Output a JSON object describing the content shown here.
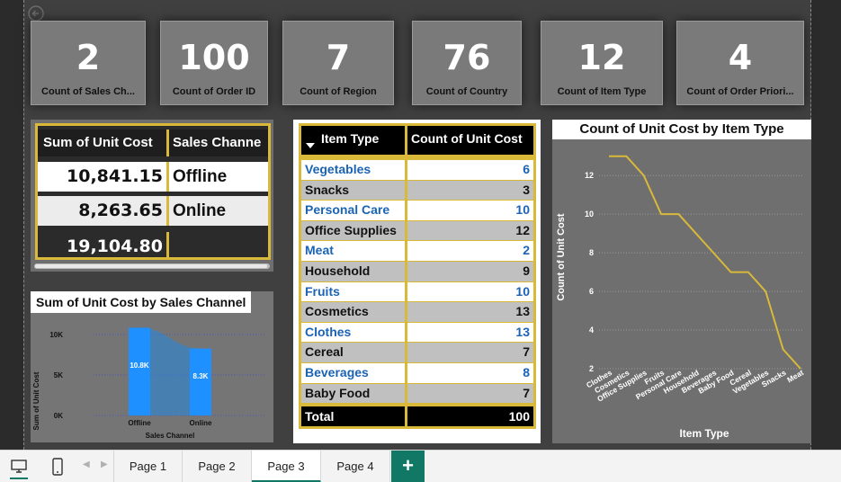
{
  "kpis": [
    {
      "value": "2",
      "label": "Count of Sales Ch..."
    },
    {
      "value": "100",
      "label": "Count of Order ID"
    },
    {
      "value": "7",
      "label": "Count of Region"
    },
    {
      "value": "76",
      "label": "Count of Country"
    },
    {
      "value": "12",
      "label": "Count of Item Type"
    },
    {
      "value": "4",
      "label": "Count of Order Priori..."
    }
  ],
  "matrix": {
    "headers": [
      "Sum of Unit Cost",
      "Sales Channe"
    ],
    "rows": [
      {
        "cost": "10,841.15",
        "channel": "Offline"
      },
      {
        "cost": "8,263.65",
        "channel": "Online"
      }
    ],
    "total": "19,104.80"
  },
  "bar_chart_title": "Sum of Unit Cost by Sales Channel",
  "line_chart_title": "Count of Unit Cost by Item Type",
  "table": {
    "headers": [
      "Item Type",
      "Count of Unit Cost"
    ],
    "rows": [
      {
        "item": "Vegetables",
        "count": "6"
      },
      {
        "item": "Snacks",
        "count": "3"
      },
      {
        "item": "Personal Care",
        "count": "10"
      },
      {
        "item": "Office Supplies",
        "count": "12"
      },
      {
        "item": "Meat",
        "count": "2"
      },
      {
        "item": "Household",
        "count": "9"
      },
      {
        "item": "Fruits",
        "count": "10"
      },
      {
        "item": "Cosmetics",
        "count": "13"
      },
      {
        "item": "Clothes",
        "count": "13"
      },
      {
        "item": "Cereal",
        "count": "7"
      },
      {
        "item": "Beverages",
        "count": "8"
      },
      {
        "item": "Baby Food",
        "count": "7"
      }
    ],
    "total_label": "Total",
    "total_value": "100"
  },
  "chart_data": [
    {
      "type": "area",
      "title": "Sum of Unit Cost by Sales Channel",
      "categories": [
        "Offline",
        "Online"
      ],
      "values": [
        10841.15,
        8263.65
      ],
      "data_labels": [
        "10.8K",
        "8.3K"
      ],
      "xlabel": "Sales Channel",
      "ylabel": "Sum of Unit Cost",
      "yticks": [
        "0K",
        "5K",
        "10K"
      ],
      "ylim": [
        0,
        12000
      ],
      "grid": true,
      "bar_color": "#1e90ff"
    },
    {
      "type": "line",
      "title": "Count of Unit Cost by Item Type",
      "categories": [
        "Clothes",
        "Cosmetics",
        "Office Supplies",
        "Fruits",
        "Personal Care",
        "Household",
        "Beverages",
        "Baby Food",
        "Cereal",
        "Vegetables",
        "Snacks",
        "Meat"
      ],
      "values": [
        13,
        13,
        12,
        10,
        10,
        9,
        8,
        7,
        7,
        6,
        3,
        2
      ],
      "xlabel": "Item Type",
      "ylabel": "Count of Unit Cost",
      "yticks": [
        "2",
        "4",
        "6",
        "8",
        "10",
        "12"
      ],
      "ylim": [
        2,
        13.5
      ],
      "grid": true,
      "line_color": "#d8b93a"
    }
  ],
  "tabs": [
    "Page 1",
    "Page 2",
    "Page 3",
    "Page 4"
  ],
  "active_tab": "Page 3",
  "add_tab_label": "+",
  "colors": {
    "accent": "#117865",
    "gold": "#d8b93a",
    "link": "#1a63b5"
  }
}
